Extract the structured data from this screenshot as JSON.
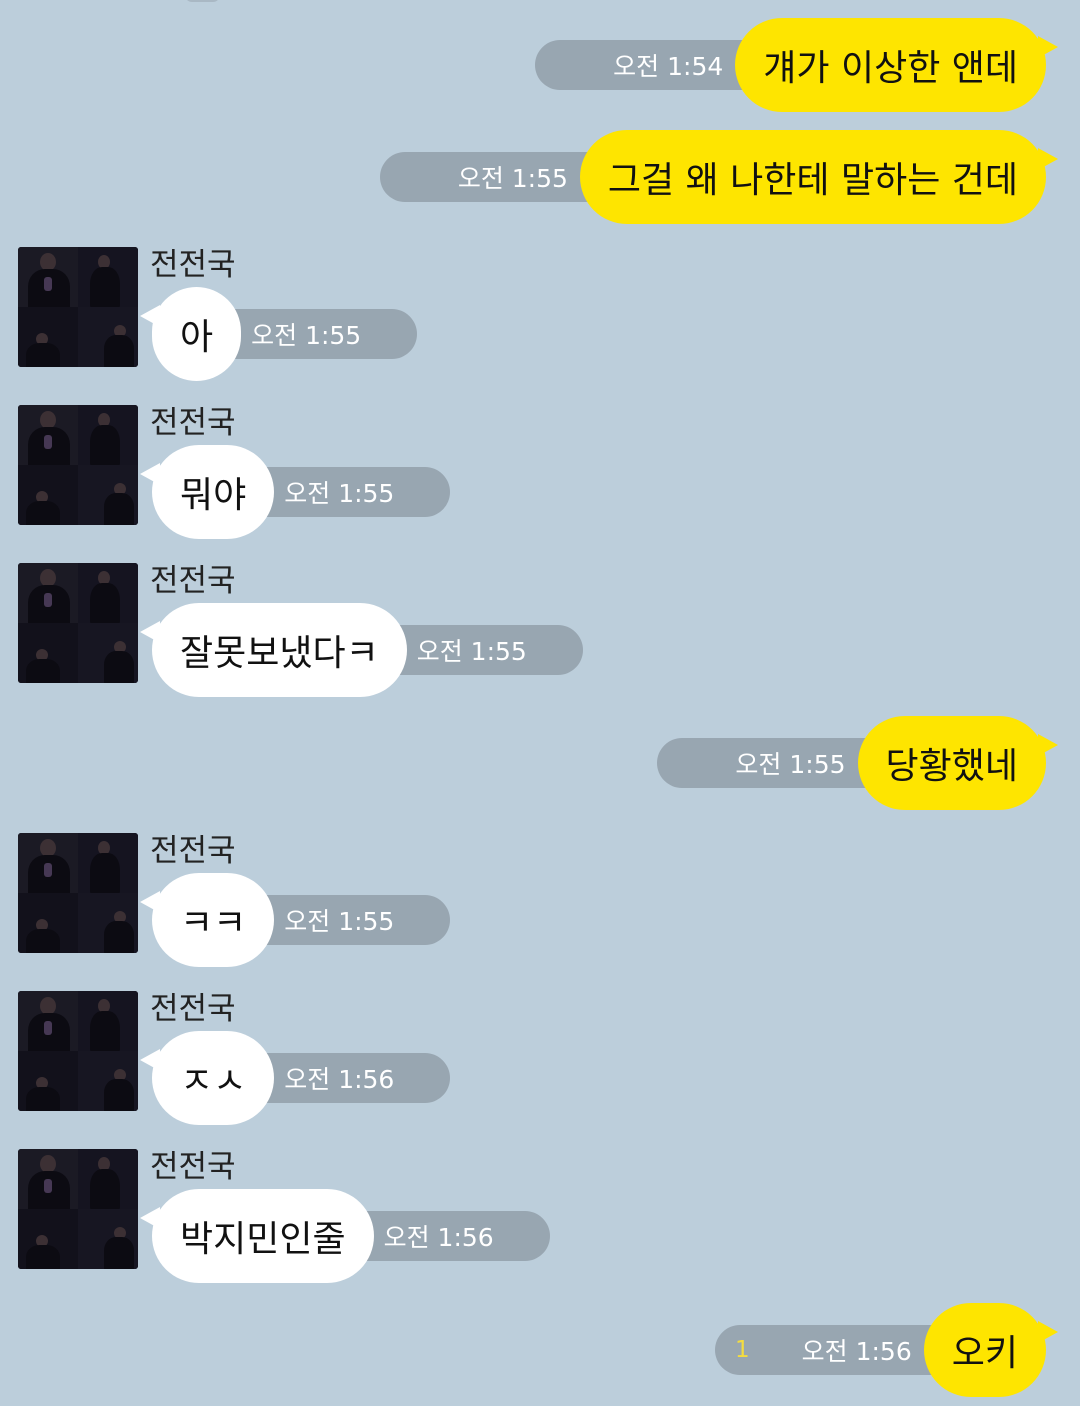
{
  "contact": {
    "name": "전전국"
  },
  "colors": {
    "background": "#bccedb",
    "outgoing_bubble": "#fee500",
    "incoming_bubble": "#ffffff",
    "time_pill": "#98a6b1",
    "unread": "#f4dc3f"
  },
  "messages": [
    {
      "direction": "out",
      "text": "걔가 이상한 앤데",
      "time": "오전 1:54"
    },
    {
      "direction": "out",
      "text": "그걸 왜 나한테 말하는 건데",
      "time": "오전 1:55"
    },
    {
      "direction": "in",
      "sender": "전전국",
      "text": "아",
      "time": "오전 1:55"
    },
    {
      "direction": "in",
      "sender": "전전국",
      "text": "뭐야",
      "time": "오전 1:55"
    },
    {
      "direction": "in",
      "sender": "전전국",
      "text": "잘못보냈다ㅋ",
      "time": "오전 1:55"
    },
    {
      "direction": "out",
      "text": "당황했네",
      "time": "오전 1:55"
    },
    {
      "direction": "in",
      "sender": "전전국",
      "text": "ㅋㅋ",
      "time": "오전 1:55"
    },
    {
      "direction": "in",
      "sender": "전전국",
      "text": "ㅈㅅ",
      "time": "오전 1:56"
    },
    {
      "direction": "in",
      "sender": "전전국",
      "text": "박지민인줄",
      "time": "오전 1:56"
    },
    {
      "direction": "out",
      "text": "오키",
      "time": "오전 1:56",
      "unread_count": "1"
    }
  ]
}
